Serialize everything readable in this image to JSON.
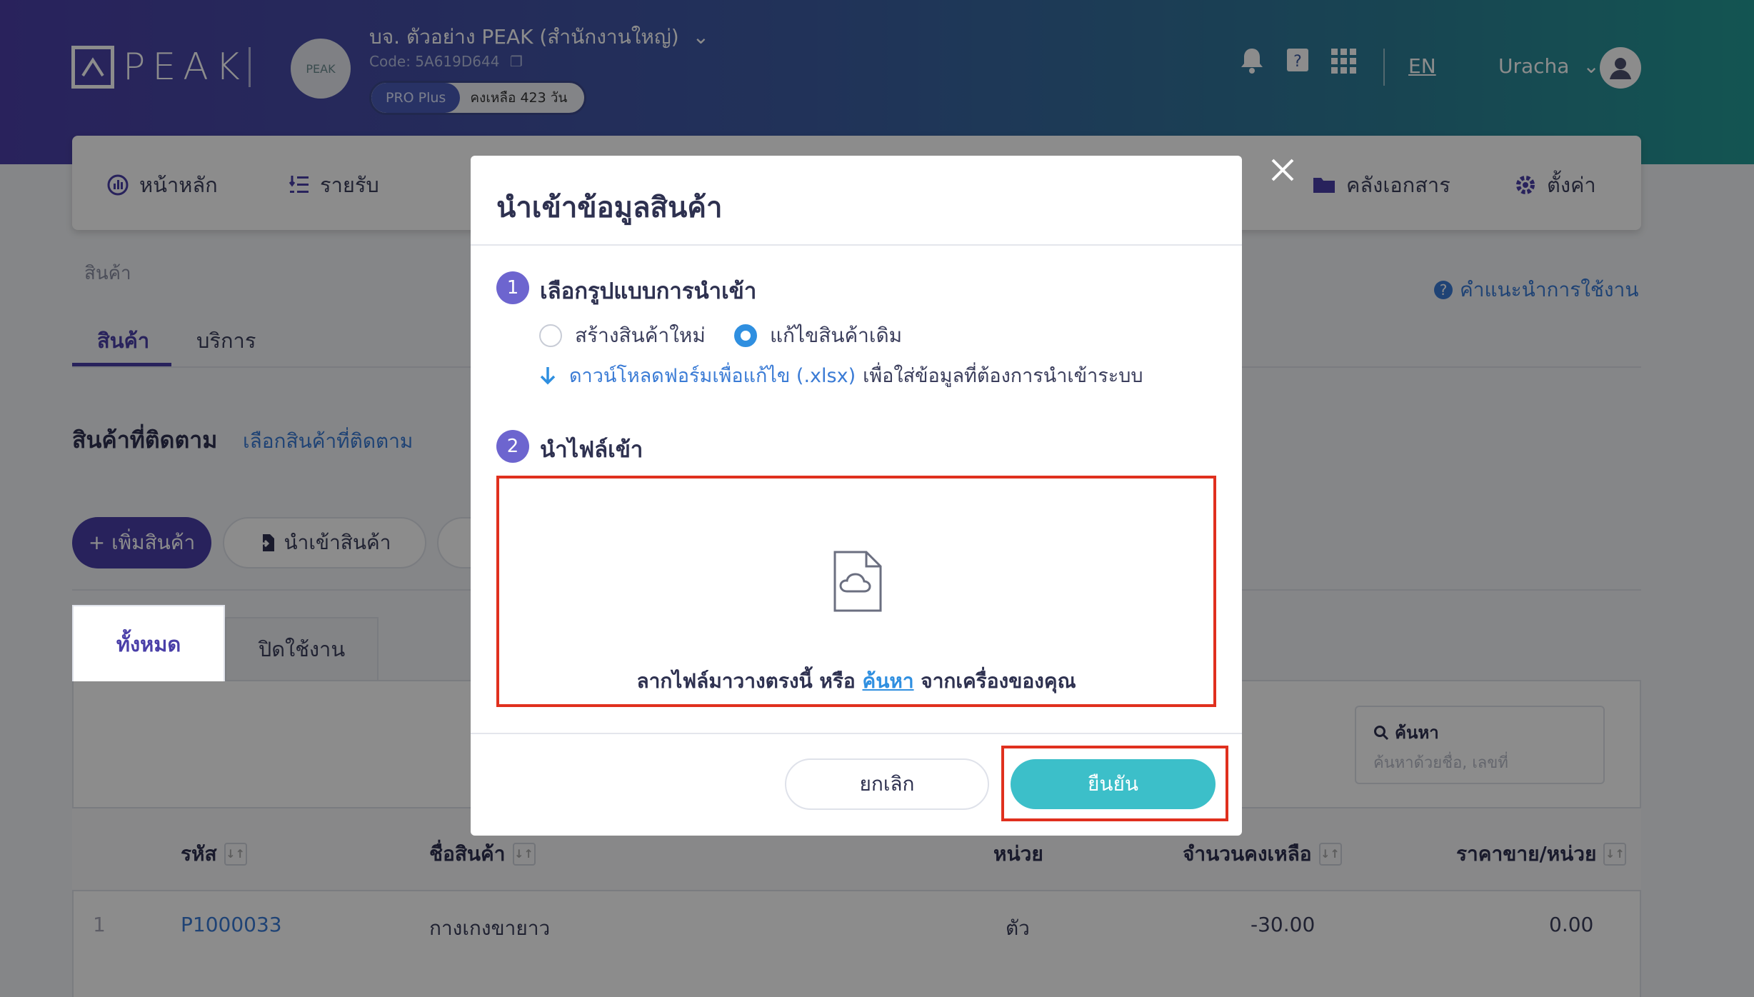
{
  "header": {
    "logo_text": "PEAK",
    "company_avatar_text": "PEAK",
    "company_name": "บจ. ตัวอย่าง PEAK (สำนักงานใหญ่)",
    "company_code": "Code: 5A619D644",
    "plan_tag": "PRO Plus",
    "plan_days": "คงเหลือ 423 วัน",
    "language": "EN",
    "user_name": "Uracha",
    "icons": [
      "bell-icon",
      "book-icon",
      "apps-grid-icon"
    ]
  },
  "nav": {
    "items": [
      {
        "label": "หน้าหลัก",
        "icon": "dashboard-icon"
      },
      {
        "label": "รายรับ",
        "icon": "income-list-icon"
      },
      {
        "label": "คลังเอกสาร",
        "icon": "folder-icon"
      },
      {
        "label": "ตั้งค่า",
        "icon": "gear-icon"
      }
    ]
  },
  "page": {
    "breadcrumb": "สินค้า",
    "help_link": "คำแนะนำการใช้งาน",
    "tabs": [
      {
        "label": "สินค้า"
      },
      {
        "label": "บริการ"
      }
    ],
    "tracked_title": "สินค้าที่ติดตาม",
    "tracked_link": "เลือกสินค้าที่ติดตาม",
    "add_button": "+ เพิ่มสินค้า",
    "import_button": "นำเข้าสินค้า",
    "panel_tabs": [
      {
        "label": "ทั้งหมด"
      },
      {
        "label": "ปิดใช้งาน"
      }
    ],
    "search_label": "ค้นหา",
    "search_placeholder": "ค้นหาด้วยชื่อ, เลขที่",
    "table": {
      "columns": [
        "รหัส",
        "ชื่อสินค้า",
        "หน่วย",
        "จำนวนคงเหลือ",
        "ราคาขาย/หน่วย"
      ],
      "rows": [
        {
          "index": "1",
          "code": "P1000033",
          "name": "กางเกงขายาว",
          "unit": "ตัว",
          "qty": "-30.00",
          "price": "0.00"
        }
      ]
    }
  },
  "modal": {
    "title": "นำเข้าข้อมูลสินค้า",
    "step1_num": "1",
    "step1_title": "เลือกรูปแบบการนำเข้า",
    "option_new": "สร้างสินค้าใหม่",
    "option_edit": "แก้ไขสินค้าเดิม",
    "selected_option": "แก้ไขสินค้าเดิม",
    "download_link": "ดาวน์โหลดฟอร์มเพื่อแก้ไข (.xlsx)",
    "download_rest": "เพื่อใส่ข้อมูลที่ต้องการนำเข้าระบบ",
    "step2_num": "2",
    "step2_title": "นำไฟล์เข้า",
    "drop_text_before": "ลากไฟล์มาวางตรงนี้ หรือ",
    "drop_link": "ค้นหา",
    "drop_text_after": "จากเครื่องของคุณ",
    "cancel": "ยกเลิก",
    "confirm": "ยืนยัน"
  },
  "colors": {
    "brand_purple": "#4a3fa8",
    "confirm_teal": "#3cbfc9",
    "link_blue": "#3a7bd5",
    "highlight_red": "#e0301e"
  }
}
